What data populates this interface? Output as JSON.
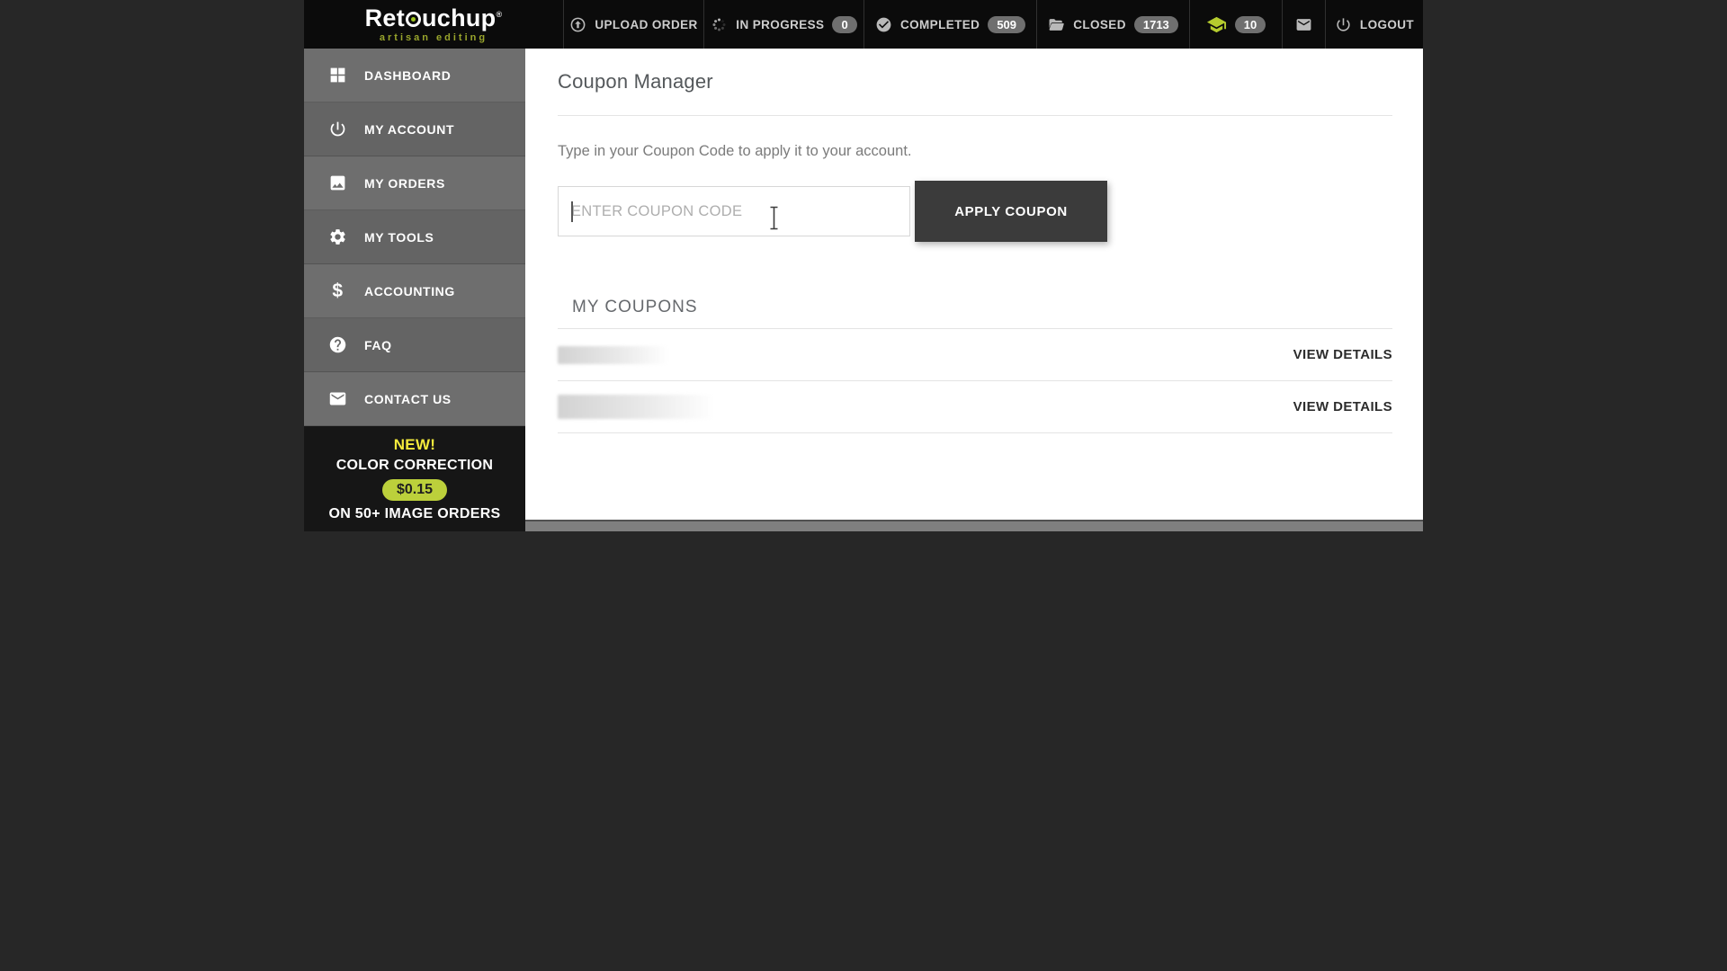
{
  "navbar": {
    "logo": {
      "brand": "Retouchup",
      "brand_pre": "Ret",
      "brand_post": "uchup",
      "reg": "®",
      "tagline": "artisan editing"
    },
    "items": [
      {
        "label": "UPLOAD ORDER",
        "icon": "upload-circle-icon"
      },
      {
        "label": "IN PROGRESS",
        "icon": "spinner-icon",
        "badge": "0"
      },
      {
        "label": "COMPLETED",
        "icon": "check-circle-icon",
        "badge": "509"
      },
      {
        "label": "CLOSED",
        "icon": "folder-open-icon",
        "badge": "1713"
      },
      {
        "label": "",
        "icon": "graduation-cap-icon",
        "badge": "10"
      },
      {
        "label": "",
        "icon": "envelope-icon"
      },
      {
        "label": "LOGOUT",
        "icon": "power-icon"
      }
    ]
  },
  "sidebar": {
    "items": [
      {
        "label": "DASHBOARD",
        "icon": "grid-icon"
      },
      {
        "label": "MY ACCOUNT",
        "icon": "power-icon"
      },
      {
        "label": "MY ORDERS",
        "icon": "photo-icon"
      },
      {
        "label": "MY TOOLS",
        "icon": "gear-icon"
      },
      {
        "label": "ACCOUNTING",
        "icon": "dollar-icon"
      },
      {
        "label": "FAQ",
        "icon": "help-circle-icon"
      },
      {
        "label": "CONTACT US",
        "icon": "envelope-icon"
      }
    ]
  },
  "promo": {
    "new_label": "NEW!",
    "title": "COLOR CORRECTION",
    "price": "$0.15",
    "subtitle": "ON 50+ IMAGE ORDERS",
    "accent_color": "#bcd03b",
    "new_color": "#f4ea3c"
  },
  "main": {
    "title": "Coupon Manager",
    "instruction": "Type in your Coupon Code to apply it to your account.",
    "coupon_input": {
      "placeholder": "ENTER COUPON CODE",
      "value": ""
    },
    "apply_button": "APPLY COUPON",
    "my_coupons": {
      "title": "MY COUPONS",
      "rows": [
        {
          "name_redacted": true,
          "action": "VIEW DETAILS"
        },
        {
          "name_redacted": true,
          "action": "VIEW DETAILS"
        }
      ]
    }
  },
  "colors": {
    "navbar_bg": "#0b0b0b",
    "sidebar_bg": "#696969",
    "outer_bg": "#272727",
    "button_bg": "#3b3b3b",
    "cap_icon": "#b5cc2e",
    "logo_tagline": "#99a52c"
  }
}
